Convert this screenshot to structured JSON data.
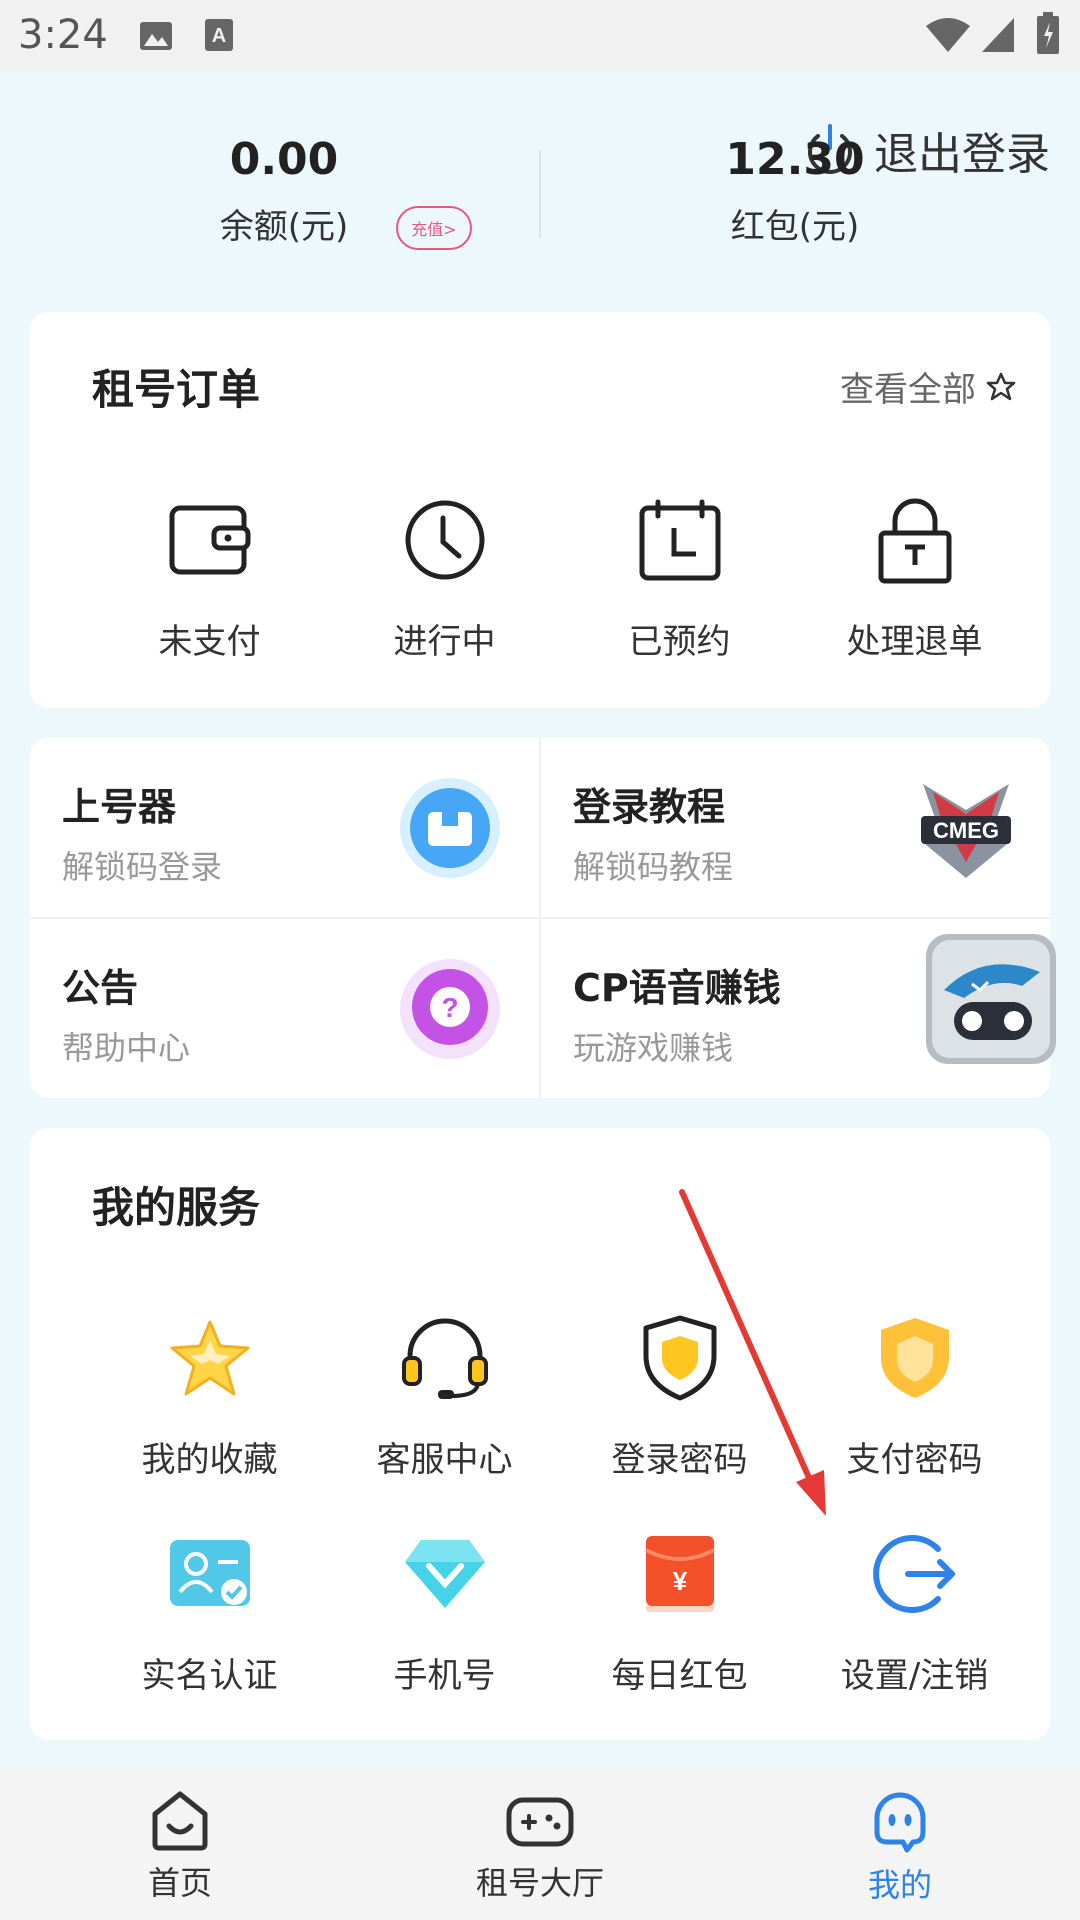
{
  "status_bar": {
    "time": "3:24"
  },
  "header": {
    "logout_label": "退出登录",
    "balance": {
      "value": "0.00",
      "label": "余额(元)",
      "recharge_label": "充值>"
    },
    "red_packet": {
      "value": "12.30",
      "label": "红包(元)"
    }
  },
  "orders": {
    "title": "租号订单",
    "view_all": "查看全部",
    "items": [
      {
        "label": "未支付",
        "icon": "wallet-icon"
      },
      {
        "label": "进行中",
        "icon": "clock-icon"
      },
      {
        "label": "已预约",
        "icon": "calendar-icon"
      },
      {
        "label": "处理退单",
        "icon": "lock-icon"
      }
    ]
  },
  "quick_links": [
    {
      "title": "上号器",
      "subtitle": "解锁码登录",
      "icon": "box-icon"
    },
    {
      "title": "登录教程",
      "subtitle": "解锁码教程",
      "icon": "cmeg-logo"
    },
    {
      "title": "公告",
      "subtitle": "帮助中心",
      "icon": "question-bubble-icon"
    },
    {
      "title": "CP语音赚钱",
      "subtitle": "玩游戏赚钱",
      "icon": "shark-gamepad-icon"
    }
  ],
  "services": {
    "title": "我的服务",
    "items": [
      {
        "label": "我的收藏",
        "icon": "star-icon"
      },
      {
        "label": "客服中心",
        "icon": "headset-icon"
      },
      {
        "label": "登录密码",
        "icon": "shield-icon"
      },
      {
        "label": "支付密码",
        "icon": "orange-shield-icon"
      },
      {
        "label": "实名认证",
        "icon": "id-card-icon"
      },
      {
        "label": "手机号",
        "icon": "diamond-icon"
      },
      {
        "label": "每日红包",
        "icon": "red-envelope-icon"
      },
      {
        "label": "设置/注销",
        "icon": "logout-circle-icon"
      }
    ]
  },
  "bottom_nav": [
    {
      "label": "首页",
      "icon": "home-icon",
      "active": false
    },
    {
      "label": "租号大厅",
      "icon": "gamepad-icon",
      "active": false
    },
    {
      "label": "我的",
      "icon": "profile-icon",
      "active": true
    }
  ],
  "colors": {
    "accent": "#2E82E8",
    "recharge": "#E8587E",
    "background": "#ECF8FC",
    "annotation": "#E53935"
  }
}
